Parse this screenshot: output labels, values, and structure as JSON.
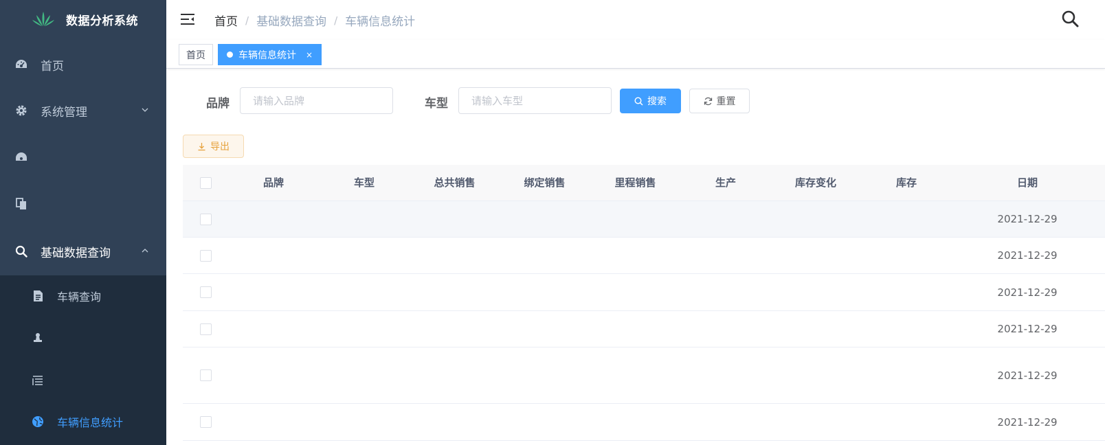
{
  "app": {
    "title": "数据分析系统"
  },
  "sidebar": {
    "items": [
      {
        "label": "首页",
        "icon": "dashboard-icon"
      },
      {
        "label": "系统管理",
        "icon": "gear-icon"
      },
      {
        "label": "",
        "icon": "chart-icon"
      },
      {
        "label": "",
        "icon": "copy-icon"
      },
      {
        "label": "基础数据查询",
        "icon": "search-icon"
      }
    ],
    "subitems": [
      {
        "label": "车辆查询",
        "icon": "document-icon"
      },
      {
        "label": "",
        "icon": "stamp-icon"
      },
      {
        "label": "",
        "icon": "list-icon"
      },
      {
        "label": "车辆信息统计",
        "icon": "globe-icon"
      }
    ],
    "colors": {
      "bg": "#304156",
      "sub_bg": "#1f2d3d",
      "text": "#bfcbd9",
      "active": "#409eff"
    }
  },
  "breadcrumb": [
    "首页",
    "基础数据查询",
    "车辆信息统计"
  ],
  "tags": {
    "home": "首页",
    "active": "车辆信息统计",
    "close": "×"
  },
  "search": {
    "brand_label": "品牌",
    "brand_placeholder": "请输入品牌",
    "model_label": "车型",
    "model_placeholder": "请输入车型",
    "search_button": "搜索",
    "reset_button": "重置",
    "export_button": "导出"
  },
  "table": {
    "columns": [
      "品牌",
      "车型",
      "总共销售",
      "绑定销售",
      "里程销售",
      "生产",
      "库存变化",
      "库存",
      "日期"
    ],
    "rows": [
      {
        "date": "2021-12-29"
      },
      {
        "date": "2021-12-29"
      },
      {
        "date": "2021-12-29"
      },
      {
        "date": "2021-12-29"
      },
      {
        "date": "2021-12-29"
      },
      {
        "date": "2021-12-29"
      }
    ]
  }
}
